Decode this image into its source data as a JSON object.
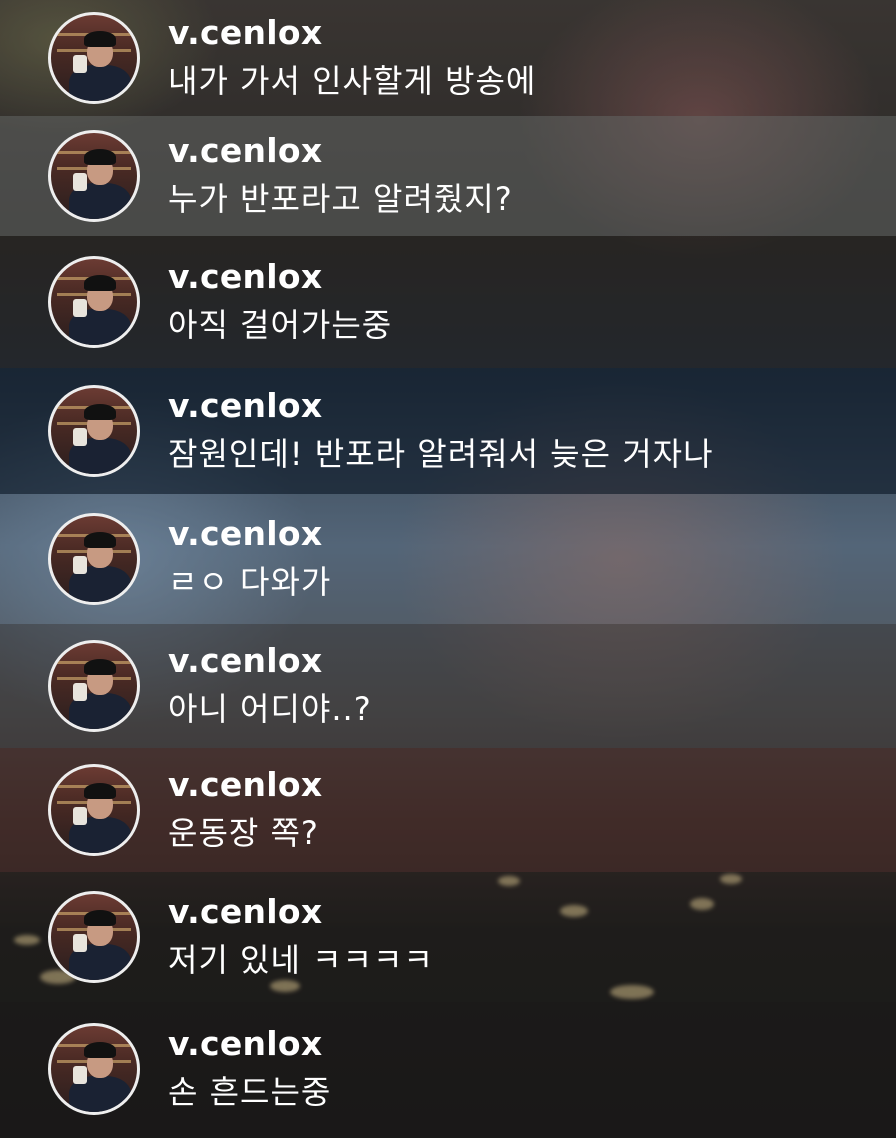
{
  "comments": [
    {
      "username": "v.cenlox",
      "message": "내가 가서 인사할게 방송에"
    },
    {
      "username": "v.cenlox",
      "message": "누가 반포라고 알려줬지?"
    },
    {
      "username": "v.cenlox",
      "message": "아직 걸어가는중"
    },
    {
      "username": "v.cenlox",
      "message": "잠원인데! 반포라 알려줘서 늦은 거자나"
    },
    {
      "username": "v.cenlox",
      "message": "ㄹㅇ 다와가"
    },
    {
      "username": "v.cenlox",
      "message": "아니 어디야..?"
    },
    {
      "username": "v.cenlox",
      "message": "운동장 쪽?"
    },
    {
      "username": "v.cenlox",
      "message": "저기 있네 ㅋㅋㅋㅋ"
    },
    {
      "username": "v.cenlox",
      "message": "손 흔드는중"
    }
  ]
}
